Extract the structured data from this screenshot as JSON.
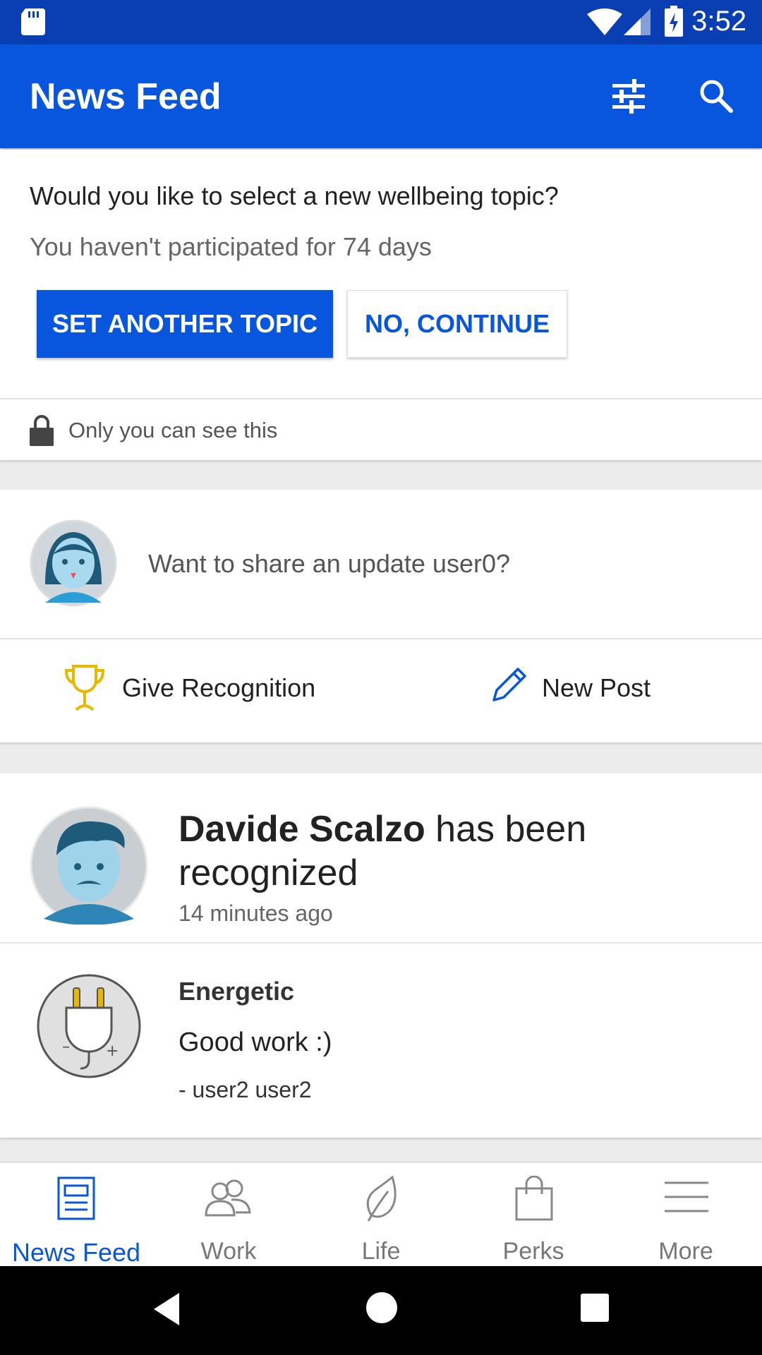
{
  "status_bar": {
    "time": "3:52"
  },
  "app_bar": {
    "title": "News Feed",
    "icons": [
      "filter-sliders-icon",
      "search-icon"
    ]
  },
  "wellbeing_prompt": {
    "question": "Would you like to select a new wellbeing topic?",
    "subtitle": "You haven't participated for 74 days",
    "primary_button": "SET ANOTHER TOPIC",
    "secondary_button": "NO, CONTINUE",
    "privacy_note": "Only you can see this"
  },
  "composer": {
    "prompt": "Want to share an update user0?",
    "actions": [
      {
        "label": "Give Recognition",
        "icon": "trophy-icon"
      },
      {
        "label": "New Post",
        "icon": "pencil-icon"
      }
    ]
  },
  "feed_post": {
    "name": "Davide Scalzo",
    "action": " has been recognized",
    "time": "14 minutes ago",
    "badge_title": "Energetic",
    "message": "Good work :)",
    "signature": "- user2 user2"
  },
  "bottom_nav": {
    "items": [
      {
        "label": "News Feed",
        "icon": "news-feed-icon",
        "active": true
      },
      {
        "label": "Work",
        "icon": "people-icon",
        "active": false
      },
      {
        "label": "Life",
        "icon": "leaf-icon",
        "active": false
      },
      {
        "label": "Perks",
        "icon": "shopping-bag-icon",
        "active": false
      },
      {
        "label": "More",
        "icon": "menu-icon",
        "active": false
      }
    ]
  },
  "colors": {
    "primary": "#0855de",
    "status_bar": "#0a3fb3",
    "trophy": "#e6b800"
  }
}
